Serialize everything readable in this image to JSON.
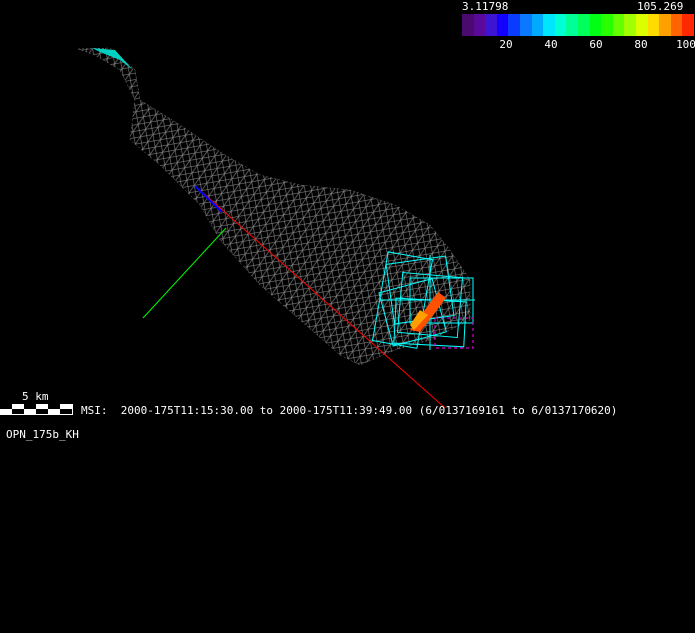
{
  "colorbar": {
    "min_label": "3.11798",
    "max_label": "105.269",
    "tick_labels": [
      "20",
      "40",
      "60",
      "80",
      "100"
    ],
    "colors": [
      "#4b0a6e",
      "#5a0a9a",
      "#3c14d2",
      "#1400ff",
      "#0a3cff",
      "#0a78ff",
      "#00aaff",
      "#00e6ff",
      "#00ffd2",
      "#00ff96",
      "#00ff5a",
      "#00ff14",
      "#28ff00",
      "#64ff00",
      "#a0ff00",
      "#dcff00",
      "#ffdc00",
      "#ffa000",
      "#ff6400",
      "#ff2800"
    ]
  },
  "scale_bar": {
    "label": "5 km"
  },
  "info": {
    "msi_line": "MSI:  2000-175T11:15:30.00 to 2000-175T11:39:49.00 (6/0137169161 to 6/0137170620)",
    "target_label": "OPN_175b_KH"
  },
  "colors": {
    "mesh": "#8c8c8c",
    "footprint": "#00ffff",
    "axis_x": "#ff0000",
    "axis_y": "#00ff00",
    "axis_z": "#0000ff",
    "highlight": "#ff00ff"
  }
}
